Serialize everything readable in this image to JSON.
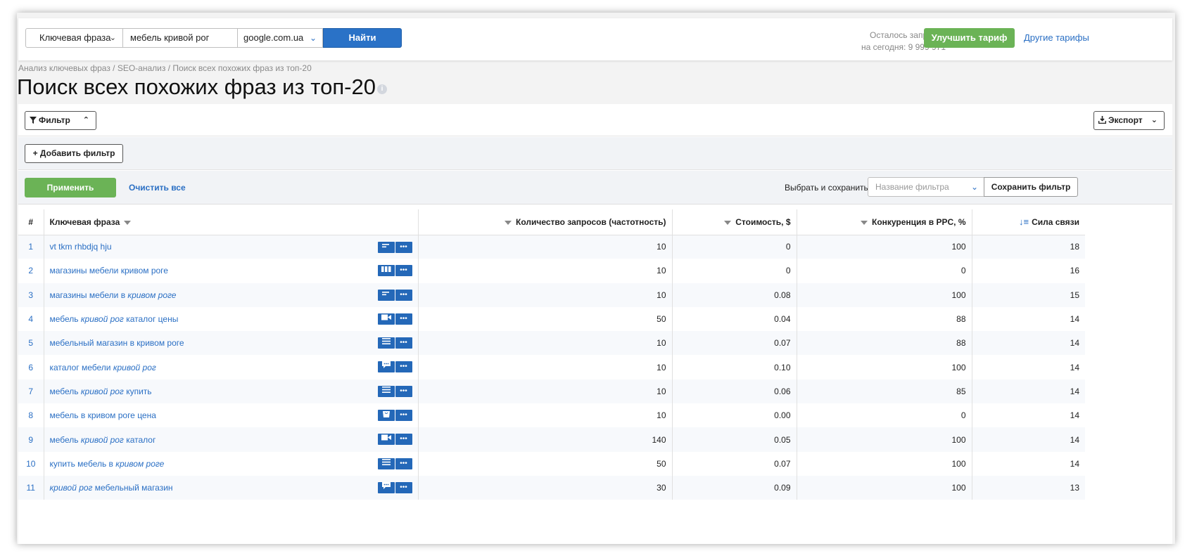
{
  "search": {
    "type_label": "Ключевая фраза",
    "query": "мебель кривой рог",
    "database": "google.com.ua",
    "find_label": "Найти"
  },
  "quota": {
    "line1": "Осталось запросов",
    "line2": "на сегодня: 9 999 971"
  },
  "header": {
    "upgrade_label": "Улучшить тариф",
    "other_tariffs": "Другие тарифы"
  },
  "breadcrumb": "Анализ ключевых фраз / SEO-анализ / Поиск всех похожих фраз из топ-20",
  "page_title": "Поиск всех похожих фраз из топ-20",
  "toolbar": {
    "filter_label": "Фильтр",
    "export_label": "Экспорт",
    "add_filter_label": "+ Добавить фильтр",
    "apply_label": "Применить",
    "clear_label": "Очистить все",
    "save_choose_label": "Выбрать и сохранить",
    "filter_name_placeholder": "Название фильтра",
    "save_filter_label": "Сохранить фильтр"
  },
  "table": {
    "columns": {
      "num": "#",
      "keyword": "Ключевая фраза",
      "volume": "Количество запросов (частотность)",
      "cost": "Стоимость, $",
      "competition": "Конкуренция в PPC, %",
      "strength": "Сила связи"
    },
    "rows": [
      {
        "n": "1",
        "kw_pre": "vt tkm rhbdjq hju",
        "kw_it": "",
        "kw_post": "",
        "icon": "lines",
        "volume": "10",
        "cost": "0",
        "comp": "100",
        "strength": "18"
      },
      {
        "n": "2",
        "kw_pre": "магазины мебели кривом роге",
        "kw_it": "",
        "kw_post": "",
        "icon": "columns",
        "volume": "10",
        "cost": "0",
        "comp": "0",
        "strength": "16"
      },
      {
        "n": "3",
        "kw_pre": "магазины мебели в ",
        "kw_it": "кривом роге",
        "kw_post": "",
        "icon": "lines",
        "volume": "10",
        "cost": "0.08",
        "comp": "100",
        "strength": "15"
      },
      {
        "n": "4",
        "kw_pre": "мебель ",
        "kw_it": "кривой рог",
        "kw_post": " каталог цены",
        "icon": "video",
        "volume": "50",
        "cost": "0.04",
        "comp": "88",
        "strength": "14"
      },
      {
        "n": "5",
        "kw_pre": "мебельный магазин в кривом роге",
        "kw_it": "",
        "kw_post": "",
        "icon": "list",
        "volume": "10",
        "cost": "0.07",
        "comp": "88",
        "strength": "14"
      },
      {
        "n": "6",
        "kw_pre": "каталог мебели ",
        "kw_it": "кривой рог",
        "kw_post": "",
        "icon": "chat",
        "volume": "10",
        "cost": "0.10",
        "comp": "100",
        "strength": "14"
      },
      {
        "n": "7",
        "kw_pre": "мебель ",
        "kw_it": "кривой рог",
        "kw_post": " купить",
        "icon": "list",
        "volume": "10",
        "cost": "0.06",
        "comp": "85",
        "strength": "14"
      },
      {
        "n": "8",
        "kw_pre": "мебель в кривом роге цена",
        "kw_it": "",
        "kw_post": "",
        "icon": "bag",
        "volume": "10",
        "cost": "0.00",
        "comp": "0",
        "strength": "14"
      },
      {
        "n": "9",
        "kw_pre": "мебель ",
        "kw_it": "кривой рог",
        "kw_post": " каталог",
        "icon": "video",
        "volume": "140",
        "cost": "0.05",
        "comp": "100",
        "strength": "14"
      },
      {
        "n": "10",
        "kw_pre": "купить мебель в ",
        "kw_it": "кривом роге",
        "kw_post": "",
        "icon": "list",
        "volume": "50",
        "cost": "0.07",
        "comp": "100",
        "strength": "14"
      },
      {
        "n": "11",
        "kw_pre": "",
        "kw_it": "кривой рог",
        "kw_post": " мебельный магазин",
        "icon": "chat",
        "volume": "30",
        "cost": "0.09",
        "comp": "100",
        "strength": "13"
      }
    ]
  },
  "colors": {
    "accent_blue": "#2a72c7",
    "accent_green": "#6bb356",
    "link": "#2a6fc4"
  }
}
